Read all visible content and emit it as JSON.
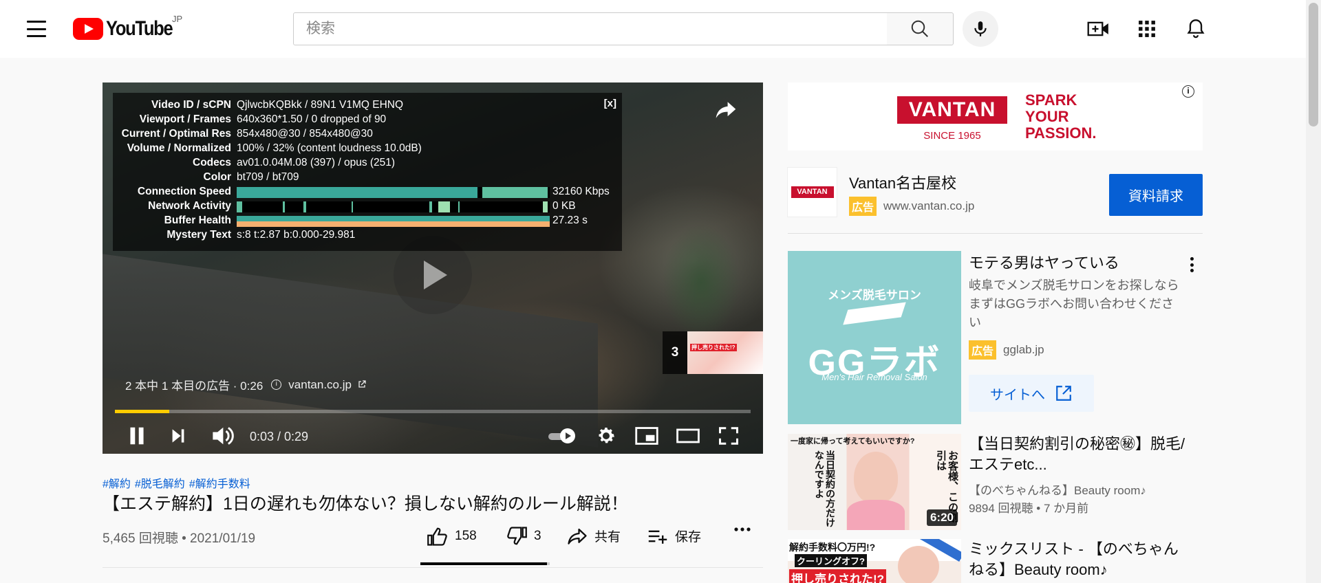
{
  "header": {
    "logo_text": "YouTube",
    "country": "JP",
    "search_placeholder": "検索"
  },
  "player": {
    "stats": [
      {
        "label": "Video ID / sCPN",
        "value": "QjlwcbKQBkk / 89N1 V1MQ EHNQ"
      },
      {
        "label": "Viewport / Frames",
        "value": "640x360*1.50 / 0 dropped of 90"
      },
      {
        "label": "Current / Optimal Res",
        "value": "854x480@30 / 854x480@30"
      },
      {
        "label": "Volume / Normalized",
        "value": "100% / 32% (content loudness 10.0dB)"
      },
      {
        "label": "Codecs",
        "value": "av01.0.04M.08 (397) / opus (251)"
      },
      {
        "label": "Color",
        "value": "bt709 / bt709"
      },
      {
        "label": "Connection Speed",
        "value": "32160 Kbps"
      },
      {
        "label": "Network Activity",
        "value": "0 KB"
      },
      {
        "label": "Buffer Health",
        "value": "27.23 s"
      },
      {
        "label": "Mystery Text",
        "value": "s:8 t:2.87 b:0.000-29.981"
      }
    ],
    "stats_close": "[x]",
    "ad_info": "2 本中 1 本目の広告 · 0:26",
    "ad_info_icon": "i",
    "ad_link": "vantan.co.jp",
    "upnext_count": "3",
    "upnext_thumb_text": "押し売りされた!?",
    "time": "0:03 / 0:29",
    "progress": 0.085
  },
  "video": {
    "hashtags": [
      "#解約",
      "#脱毛解約",
      "#解約手数料"
    ],
    "title": "【エステ解約】1日の遅れも勿体ない？損しない解約のルール解説！",
    "views": "5,465 回視聴 • 2021/01/19",
    "likes": "158",
    "dislikes": "3",
    "share": "共有",
    "save": "保存",
    "like_ratio": 0.98
  },
  "sidebar": {
    "banner": {
      "logo": "VANTAN",
      "since": "SINCE 1965",
      "slogan": [
        "SPARK",
        "YOUR",
        "PASSION."
      ],
      "info": "i"
    },
    "advertiser": {
      "logo": "VANTAN",
      "name": "Vantan名古屋校",
      "badge": "広告",
      "domain": "www.vantan.co.jp",
      "cta": "資料請求"
    },
    "promo": {
      "img_line1": "メンズ脱毛サロン",
      "img_line2": "GGラボ",
      "img_line3": "Men's Hair Removal Salon",
      "title": "モテる男はヤっている",
      "description": "岐阜でメンズ脱毛サロンをお探しならまずはGGラボへお問い合わせください",
      "badge": "広告",
      "domain": "gglab.jp",
      "site_button": "サイトへ"
    },
    "recommendations": [
      {
        "title": "【当日契約割引の秘密㊙】脱毛/エステetc...",
        "channel": "【のべちゃんねる】Beauty room♪",
        "stats": "9894 回視聴 • 7 か月前",
        "duration": "6:20",
        "thumb_text1": "一度家に帰って考えてもいいですか?",
        "thumb_text2": "当日契約の方だけなんですよ",
        "thumb_text3": "お客様、この割引は"
      },
      {
        "title": "ミックスリスト - 【のべちゃんねる】Beauty room♪",
        "thumb_text1": "解約手数料〇万円!?",
        "thumb_text2": "クーリングオフ?",
        "thumb_text3": "押し売りされた!?"
      }
    ]
  },
  "colors": {
    "brand_red": "#ff0000",
    "link_blue": "#065fd4",
    "ad_badge": "#fbc02d",
    "vantan_red": "#c8102e",
    "progress_yellow": "#ffcc00"
  }
}
